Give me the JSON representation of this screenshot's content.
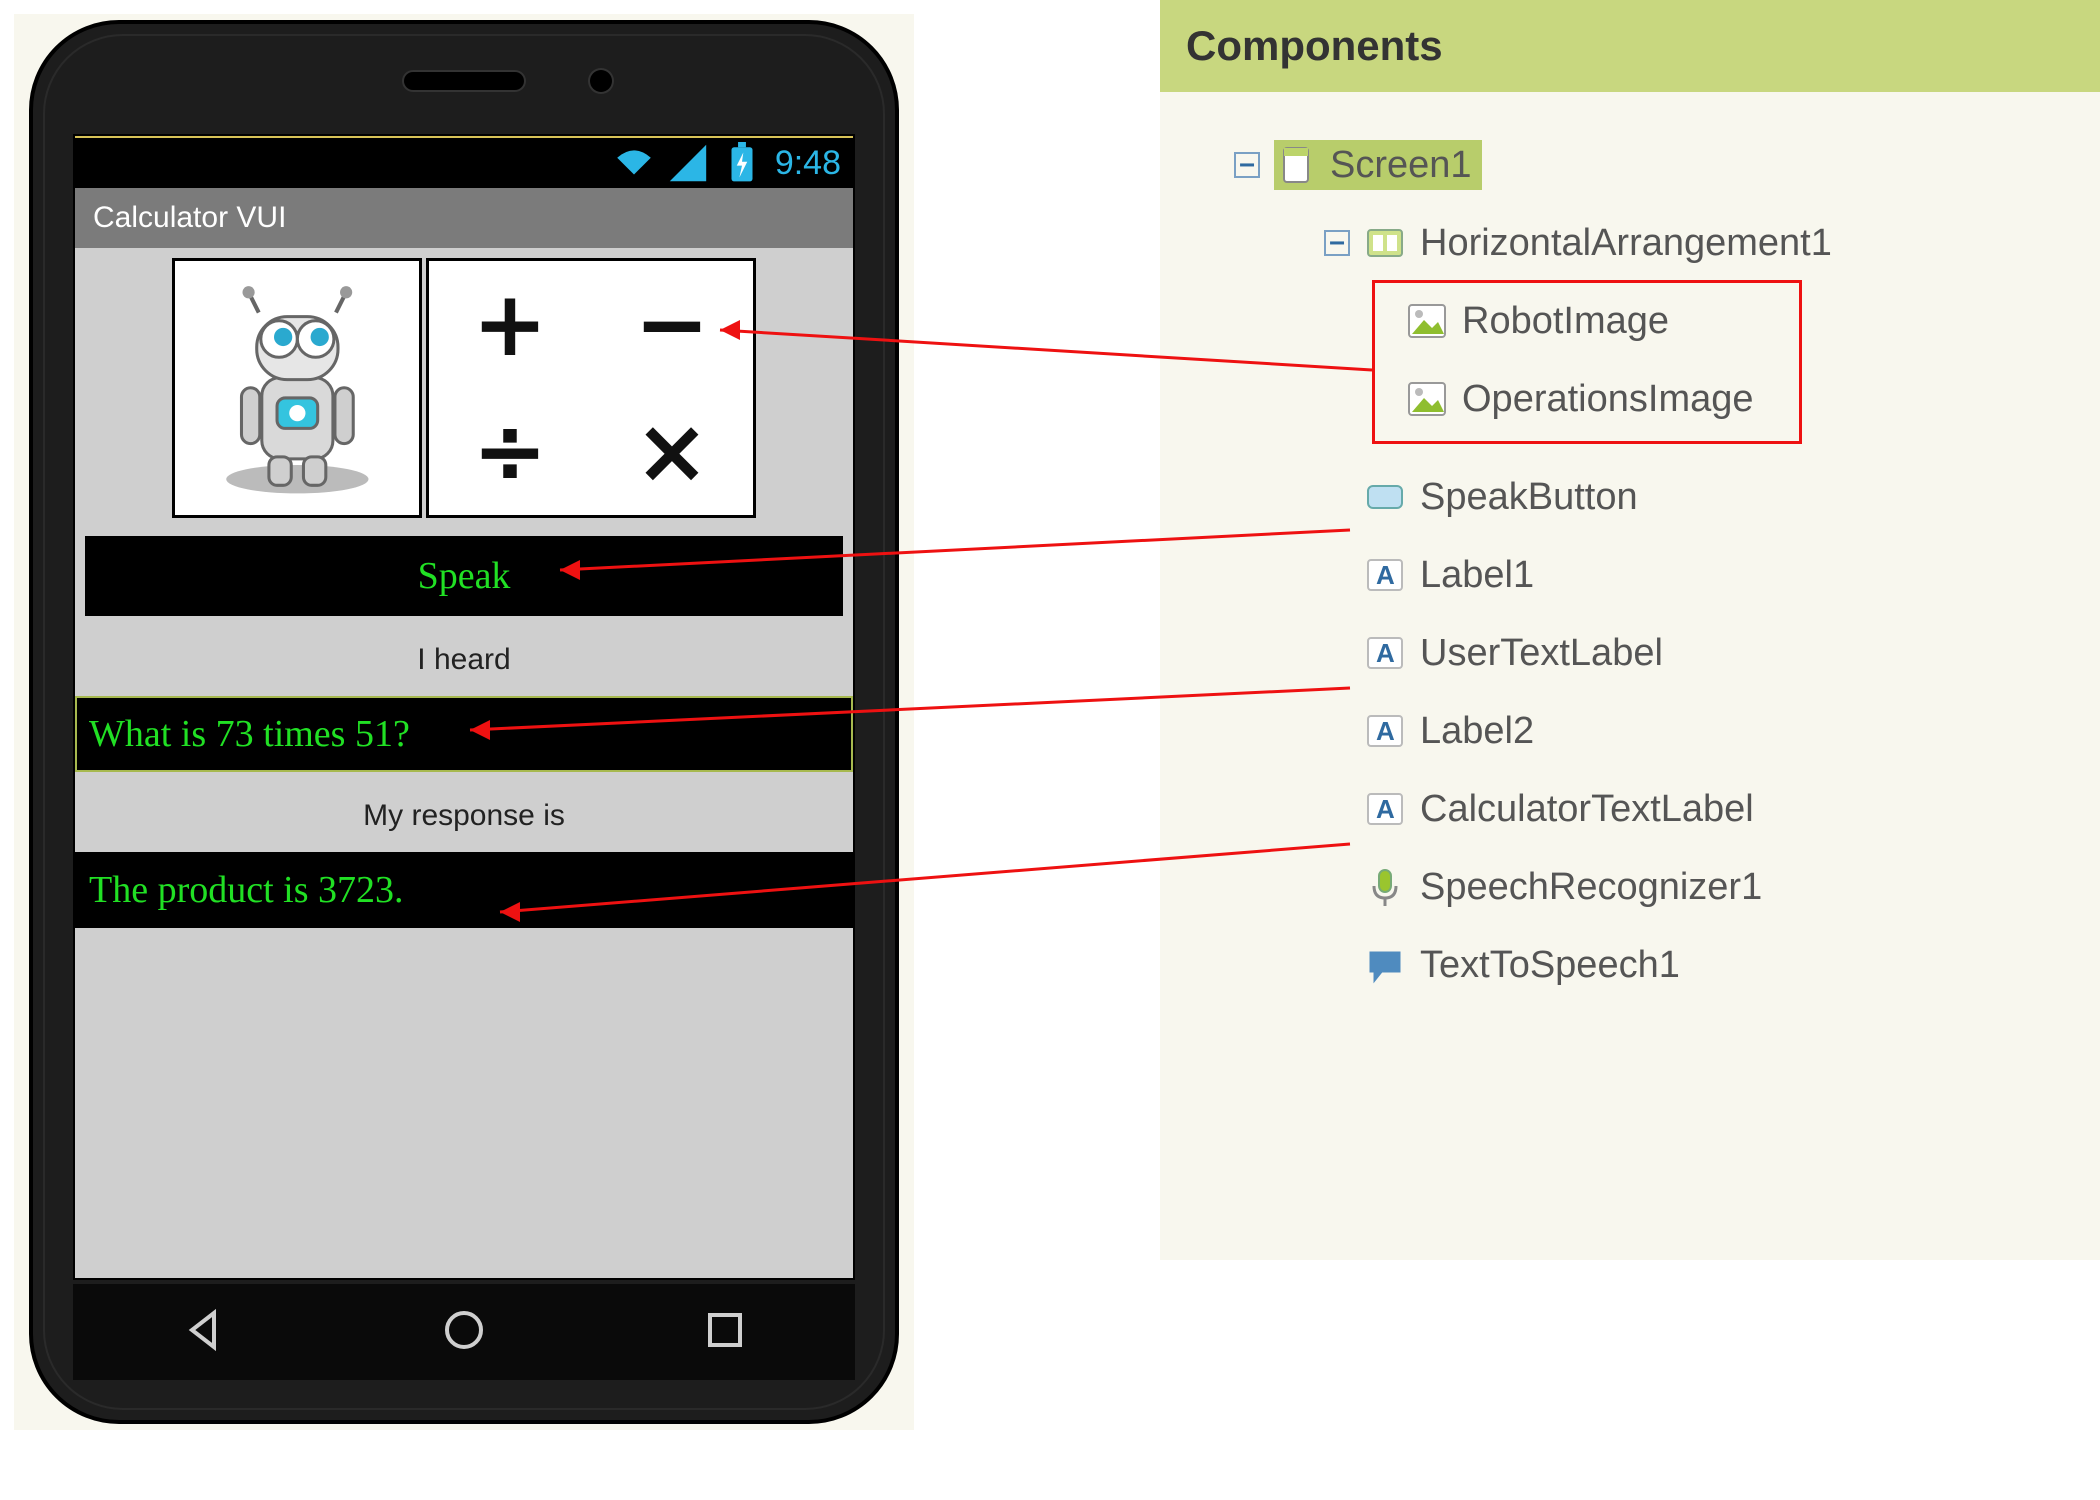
{
  "status": {
    "time": "9:48"
  },
  "app": {
    "title": "Calculator VUI",
    "speak_label": "Speak",
    "label1": "I heard",
    "user_text": "What is 73 times 51?",
    "label2": "My response is",
    "calc_text": "The product is 3723."
  },
  "ops": {
    "plus": "+",
    "minus": "−",
    "divide": "÷",
    "times": "×"
  },
  "panel": {
    "title": "Components",
    "tree": {
      "screen": "Screen1",
      "harr": "HorizontalArrangement1",
      "robot": "RobotImage",
      "ops": "OperationsImage",
      "speak": "SpeakButton",
      "l1": "Label1",
      "usertxt": "UserTextLabel",
      "l2": "Label2",
      "calctxt": "CalculatorTextLabel",
      "sr": "SpeechRecognizer1",
      "tts": "TextToSpeech1"
    }
  }
}
